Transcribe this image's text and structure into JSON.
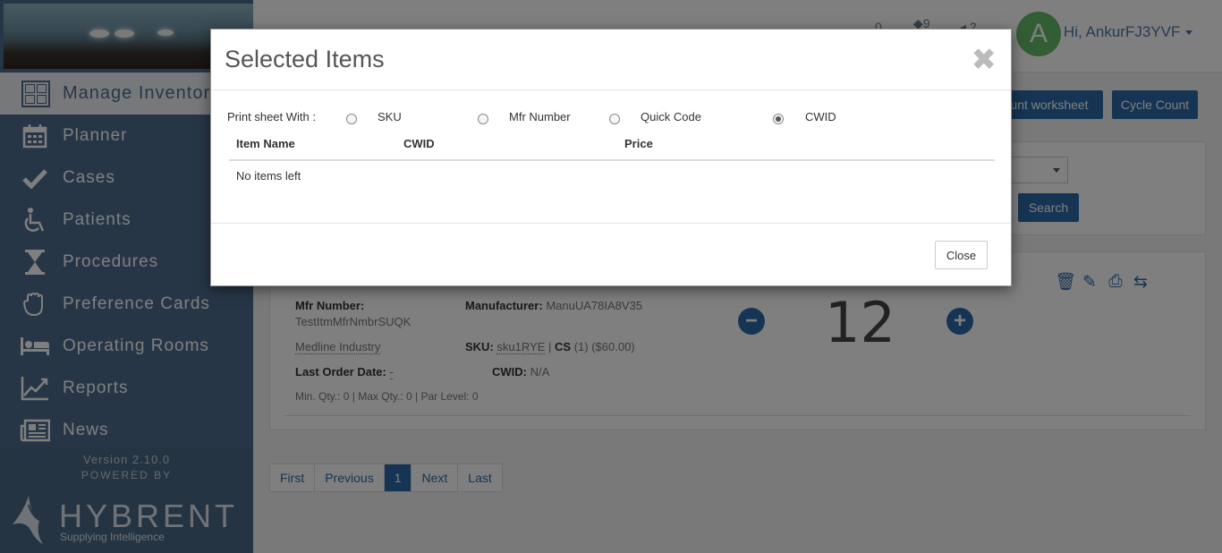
{
  "sidebar": {
    "manage_inventory": "Manage Inventory",
    "items": [
      {
        "label": "Planner",
        "icon": "calendar-icon"
      },
      {
        "label": "Cases",
        "icon": "checkmark-icon"
      },
      {
        "label": "Patients",
        "icon": "wheelchair-icon"
      },
      {
        "label": "Procedures",
        "icon": "hourglass-icon"
      },
      {
        "label": "Preference Cards",
        "icon": "hand-icon"
      },
      {
        "label": "Operating Rooms",
        "icon": "bed-icon"
      },
      {
        "label": "Reports",
        "icon": "line-chart-icon"
      },
      {
        "label": "News",
        "icon": "newspaper-icon"
      }
    ],
    "version": "Version 2.10.0",
    "powered_by": "POWERED BY",
    "brand": "HYBRENT",
    "tagline": "Supplying Intelligence"
  },
  "header": {
    "notif_counts": [
      "0",
      "9",
      "2"
    ],
    "avatar_letter": "A",
    "greeting": "Hi, AnkurFJ3YVF"
  },
  "toolbar": {
    "count_worksheet": "unt worksheet",
    "cycle_count": "Cycle Count",
    "search": "Search"
  },
  "item": {
    "mfr_number_label": "Mfr Number:",
    "mfr_number_value": "TestItmMfrNmbrSUQK",
    "manufacturer_label": "Manufacturer:",
    "manufacturer_value": "ManuUA78IA8V35",
    "vendor": "Medline Industry",
    "sku_label": "SKU:",
    "sku_value": "sku1RYE",
    "cs_label": "CS",
    "cs_value": "(1) ($60.00)",
    "last_order_label": "Last Order Date:",
    "last_order_value": "-",
    "cwid_label": "CWID:",
    "cwid_value": "N/A",
    "levels": "Min. Qty.: 0 | Max Qty.: 0 | Par Level: 0",
    "quantity": "12"
  },
  "pagination": [
    "First",
    "Previous",
    "1",
    "Next",
    "Last"
  ],
  "modal": {
    "title": "Selected Items",
    "print_label": "Print sheet With :",
    "options": [
      {
        "label": "SKU",
        "checked": false
      },
      {
        "label": "Mfr Number",
        "checked": false
      },
      {
        "label": "Quick Code",
        "checked": false
      },
      {
        "label": "CWID",
        "checked": true
      }
    ],
    "columns": [
      "Item Name",
      "CWID",
      "Price"
    ],
    "empty_message": "No items left",
    "close_label": "Close"
  }
}
